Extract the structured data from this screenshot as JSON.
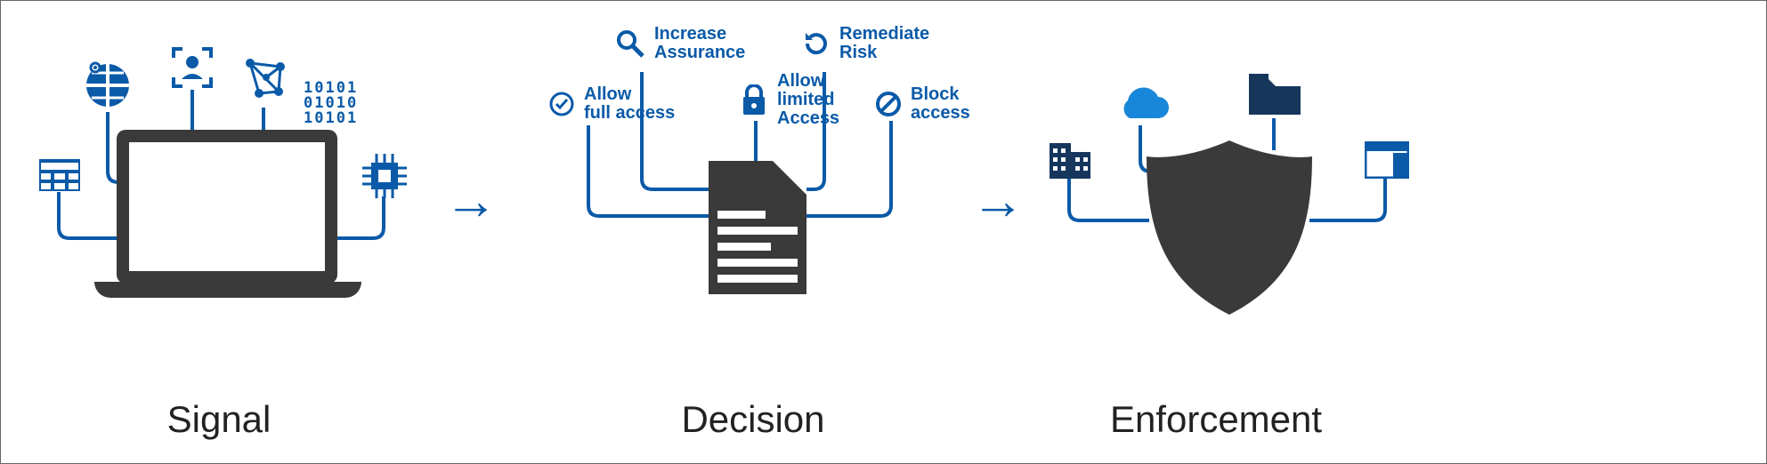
{
  "stages": {
    "signal": "Signal",
    "decision": "Decision",
    "enforcement": "Enforcement"
  },
  "signal": {
    "inputs": [
      "calendar",
      "globe",
      "user",
      "network",
      "binary",
      "chip"
    ],
    "binary_text": "10101\n01010\n10101"
  },
  "decision": {
    "allow_full": "Allow\nfull access",
    "increase_assurance": "Increase\nAssurance",
    "allow_limited": "Allow\nlimited\nAccess",
    "remediate_risk": "Remediate\nRisk",
    "block_access": "Block\naccess"
  },
  "enforcement": {
    "targets": [
      "building",
      "cloud",
      "folder",
      "browser"
    ]
  }
}
